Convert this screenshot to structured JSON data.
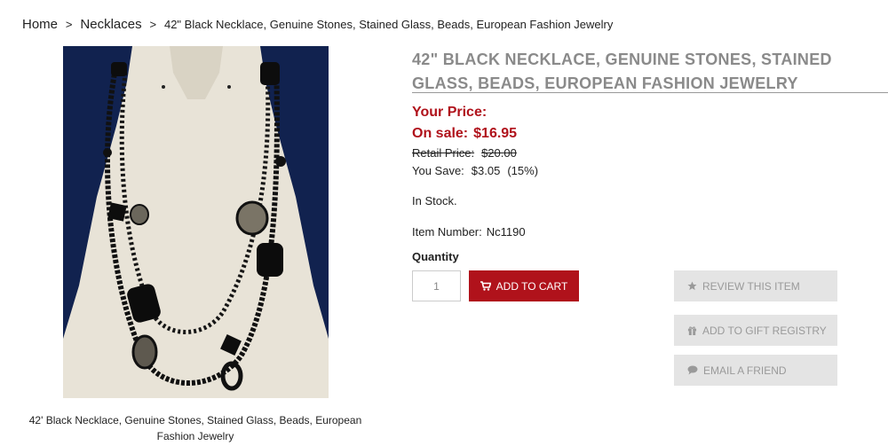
{
  "breadcrumb": {
    "home": "Home",
    "sep1": ">",
    "category": "Necklaces",
    "sep2": ">",
    "current": "42\" Black Necklace, Genuine Stones, Stained Glass, Beads, European Fashion Jewelry"
  },
  "product": {
    "title": "42\" Black Necklace, Genuine Stones, Stained Glass, Beads, European Fashion Jewelry",
    "image_caption": "42' Black Necklace, Genuine Stones, Stained Glass, Beads, European Fashion Jewelry",
    "your_price_label": "Your Price:",
    "on_sale_label": "On sale:",
    "sale_price": "$16.95",
    "retail_label": "Retail Price:",
    "retail_price": "$20.00",
    "you_save_label": "You Save:",
    "you_save_amount": "$3.05",
    "you_save_percent": "(15%)",
    "stock_status": "In Stock.",
    "item_number_label": "Item Number:",
    "item_number": "Nc1190"
  },
  "purchase": {
    "quantity_label": "Quantity",
    "quantity_value": "1",
    "add_to_cart_label": "ADD TO CART"
  },
  "actions": {
    "review_label": "REVIEW THIS ITEM",
    "gift_registry_label": "ADD TO GIFT REGISTRY",
    "email_friend_label": "EMAIL A FRIEND"
  },
  "colors": {
    "accent_red": "#b0121b",
    "title_gray": "#8a8a8a",
    "button_gray": "#e4e4e4"
  },
  "icons": {
    "cart": "shopping-cart-icon",
    "review": "star-icon",
    "gift": "gift-icon",
    "email": "speech-bubble-icon"
  }
}
